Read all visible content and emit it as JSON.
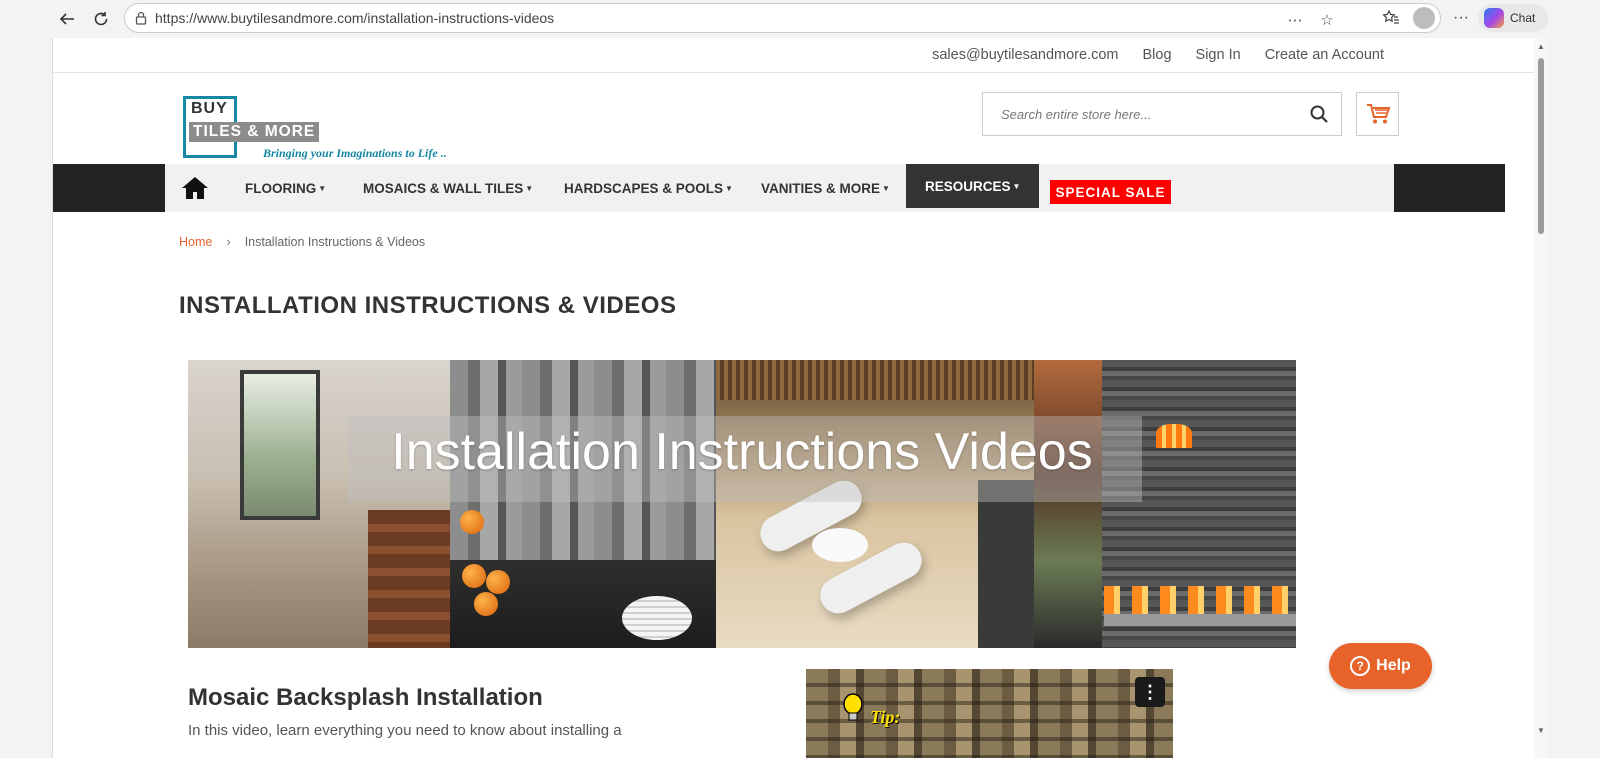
{
  "browser": {
    "url": "https://www.buytilesandmore.com/installation-instructions-videos",
    "chat_label": "Chat"
  },
  "top_links": {
    "email": "sales@buytilesandmore.com",
    "blog": "Blog",
    "sign_in": "Sign In",
    "create_account": "Create an Account"
  },
  "logo": {
    "line1": "BUY",
    "line2": "TILES & MORE",
    "tagline": "Bringing your Imaginations to Life .."
  },
  "search": {
    "placeholder": "Search entire store here..."
  },
  "nav": {
    "items": [
      {
        "label": "FLOORING"
      },
      {
        "label": "MOSAICS & WALL TILES"
      },
      {
        "label": "HARDSCAPES & POOLS"
      },
      {
        "label": "VANITIES & MORE"
      },
      {
        "label": "RESOURCES"
      }
    ],
    "sale": "SPECIAL SALE"
  },
  "breadcrumb": {
    "home": "Home",
    "current": "Installation Instructions & Videos"
  },
  "page_title": "INSTALLATION INSTRUCTIONS & VIDEOS",
  "banner": {
    "text": "Installation Instructions Videos"
  },
  "video_section": {
    "title": "Mosaic Backsplash Installation",
    "description": "In this video, learn everything you need to know about installing a",
    "thumb_text": "Tip:"
  },
  "help": {
    "label": "Help"
  },
  "colors": {
    "accent_orange": "#e8632a",
    "brand_teal": "#1687a4",
    "sale_red": "#ff0000",
    "nav_dark": "#232323"
  }
}
